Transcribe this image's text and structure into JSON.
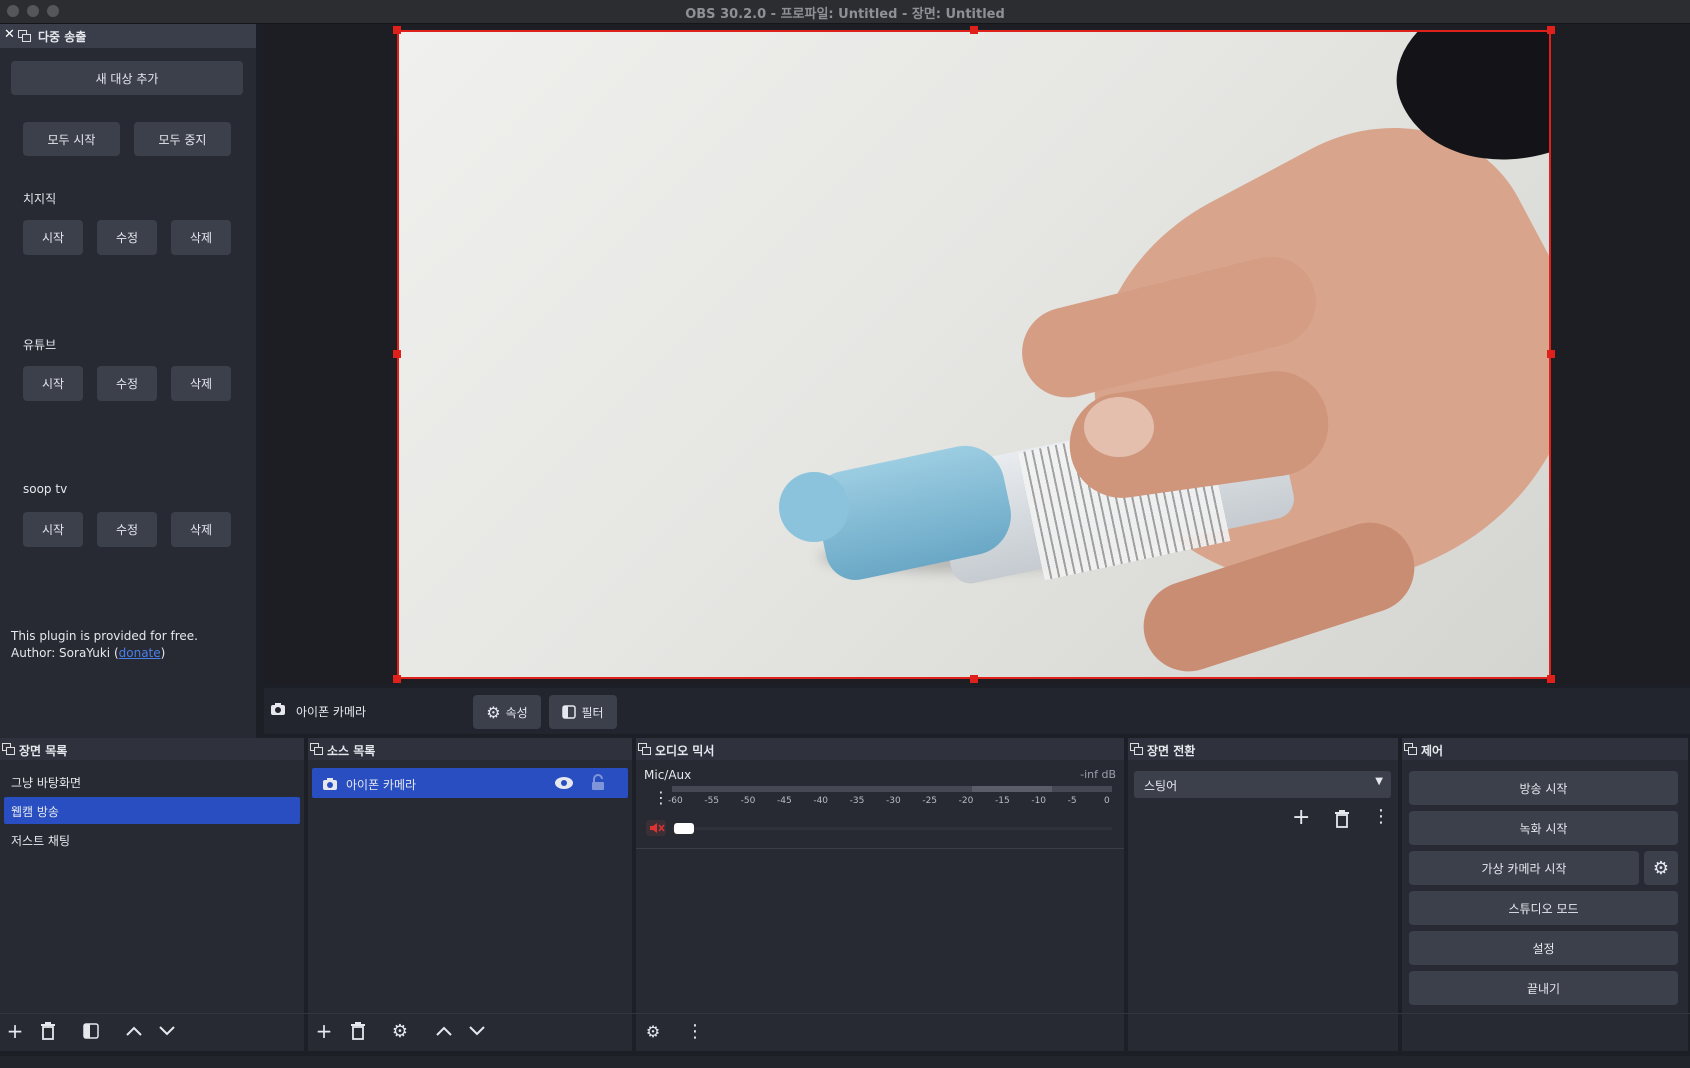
{
  "window": {
    "title": "OBS 30.2.0 - 프로파일: Untitled - 장면: Untitled"
  },
  "multistream": {
    "title": "다중 송출",
    "add_target": "새 대상 추가",
    "start_all": "모두 시작",
    "stop_all": "모두 중지",
    "targets": [
      {
        "name": "치지직",
        "start": "시작",
        "edit": "수정",
        "delete": "삭제"
      },
      {
        "name": "유튜브",
        "start": "시작",
        "edit": "수정",
        "delete": "삭제"
      },
      {
        "name": "soop tv",
        "start": "시작",
        "edit": "수정",
        "delete": "삭제"
      }
    ],
    "footer_line1": "This plugin is provided for free.",
    "footer_author_prefix": "Author: SoraYuki (",
    "footer_link": "donate",
    "footer_author_suffix": ")"
  },
  "source_toolbar": {
    "source_name": "아이폰 카메라",
    "properties": "속성",
    "filters": "필터"
  },
  "scenes": {
    "title": "장면 목록",
    "items": [
      "그냥 바탕화면",
      "웹캠 방송",
      "저스트 채팅"
    ],
    "selected_index": 1
  },
  "sources": {
    "title": "소스 목록",
    "items": [
      "아이폰 카메라"
    ]
  },
  "audio": {
    "title": "오디오 믹서",
    "channel": "Mic/Aux",
    "level": "-inf dB",
    "ticks": [
      "-60",
      "-55",
      "-50",
      "-45",
      "-40",
      "-35",
      "-30",
      "-25",
      "-20",
      "-15",
      "-10",
      "-5",
      "0"
    ]
  },
  "transitions": {
    "title": "장면 전환",
    "selected": "스팅어"
  },
  "controls": {
    "title": "제어",
    "start_stream": "방송 시작",
    "start_record": "녹화 시작",
    "start_virtual_cam": "가상 카메라 시작",
    "studio_mode": "스튜디오 모드",
    "settings": "설정",
    "exit": "끝내기"
  },
  "colors": {
    "accent": "#284ec2",
    "selection_border": "#e0201a",
    "link": "#4b7fe8"
  }
}
